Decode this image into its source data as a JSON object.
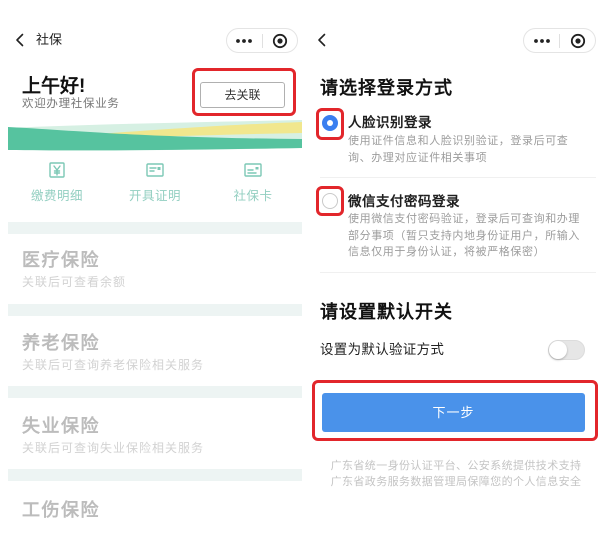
{
  "left_screen": {
    "nav": {
      "back_icon": "chevron-left-icon",
      "title": "社保",
      "more_icon": "more-dots-icon",
      "close_icon": "target-circle-icon"
    },
    "greeting": {
      "title": "上午好!",
      "subtitle": "欢迎办理社保业务"
    },
    "link_button": {
      "label": "去关联"
    },
    "quick_actions": [
      {
        "label": "缴费明细",
        "icon": "yen-receipt-icon"
      },
      {
        "label": "开具证明",
        "icon": "certificate-icon"
      },
      {
        "label": "社保卡",
        "icon": "card-icon"
      }
    ],
    "insurance_sections": [
      {
        "title": "医疗保险",
        "subtitle": "关联后可查看余额"
      },
      {
        "title": "养老保险",
        "subtitle": "关联后可查询养老保险相关服务"
      },
      {
        "title": "失业保险",
        "subtitle": "关联后可查询失业保险相关服务"
      },
      {
        "title": "工伤保险"
      }
    ]
  },
  "right_screen": {
    "nav": {
      "back_icon": "chevron-left-icon",
      "more_icon": "more-dots-icon",
      "close_icon": "target-circle-icon"
    },
    "login_method": {
      "heading": "请选择登录方式",
      "options": [
        {
          "title": "人脸识别登录",
          "description": "使用证件信息和人脸识别验证，登录后可查询、办理对应证件相关事项",
          "selected": true
        },
        {
          "title": "微信支付密码登录",
          "description": "使用微信支付密码验证，登录后可查询和办理部分事项（暂只支持内地身份证用户，所输入信息仅用于身份认证，将被严格保密）",
          "selected": false
        }
      ]
    },
    "default_switch": {
      "heading": "请设置默认开关",
      "label": "设置为默认验证方式",
      "enabled": false
    },
    "next_button": {
      "label": "下一步"
    },
    "footer": {
      "lines": [
        "广东省统一身份认证平台、公安系统提供技术支持",
        "广东省政务服务数据管理局保障您的个人信息安全"
      ]
    }
  },
  "colors": {
    "radio_blue": "#3a7ff0",
    "button_blue": "#4a92ea",
    "highlight_red": "#e2262b",
    "teal": "#7cc8b5",
    "muted_gray": "#bcbcbc",
    "banner_teal": "#56c39f",
    "banner_yellow": "#f1e78e",
    "banner_mint": "#d6f0e3"
  }
}
